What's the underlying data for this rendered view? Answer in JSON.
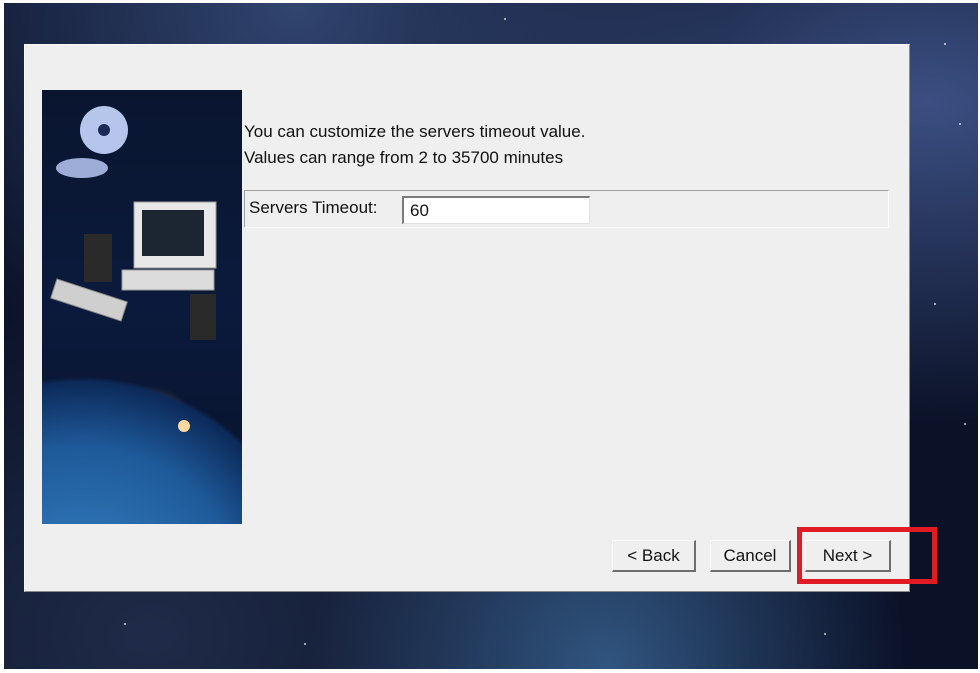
{
  "dialog": {
    "intro_line1": "You can customize the servers timeout value.",
    "intro_line2": "Values can range from 2 to 35700 minutes",
    "timeout_label": "Servers Timeout:",
    "timeout_value": "60"
  },
  "buttons": {
    "back": "< Back",
    "cancel": "Cancel",
    "next": "Next >"
  },
  "colors": {
    "highlight": "#e01b24",
    "dialog_bg": "#efefef"
  }
}
